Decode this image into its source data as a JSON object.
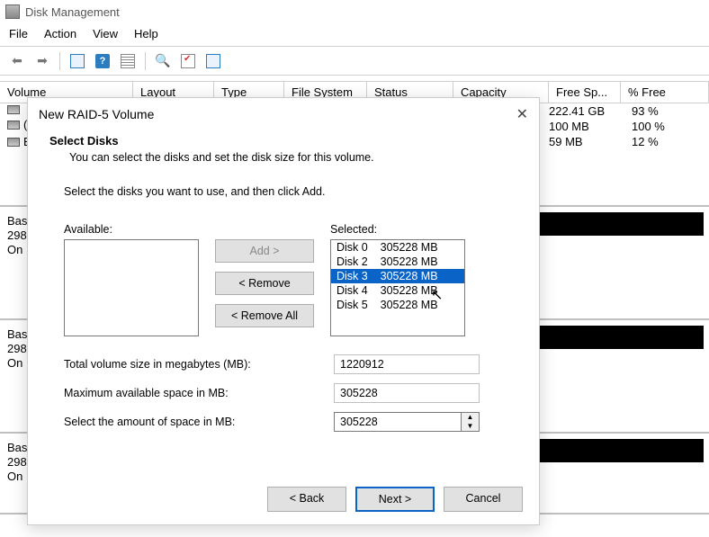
{
  "app": {
    "title": "Disk Management"
  },
  "menu": {
    "file": "File",
    "action": "Action",
    "view": "View",
    "help": "Help"
  },
  "columns": {
    "volume": "Volume",
    "layout": "Layout",
    "type": "Type",
    "fs": "File System",
    "status": "Status",
    "capacity": "Capacity",
    "free": "Free Sp...",
    "pct": "% Free"
  },
  "visible_rows": [
    {
      "free": "222.41 GB",
      "pct": "93 %"
    },
    {
      "free": "100 MB",
      "pct": "100 %"
    },
    {
      "free": "59 MB",
      "pct": "12 %"
    }
  ],
  "disk_panels": [
    {
      "l1": "Bas",
      "l2": "298",
      "l3": "On"
    },
    {
      "l1": "Bas",
      "l2": "298",
      "l3": "On"
    },
    {
      "l1": "Bas",
      "l2": "298",
      "l3": "On"
    }
  ],
  "wizard": {
    "title": "New RAID-5 Volume",
    "heading": "Select Disks",
    "subheading": "You can select the disks and set the disk size for this volume.",
    "instruction": "Select the disks you want to use, and then click Add.",
    "available_label": "Available:",
    "selected_label": "Selected:",
    "buttons": {
      "add": "Add >",
      "remove": "< Remove",
      "remove_all": "< Remove All",
      "back": "< Back",
      "next": "Next >",
      "cancel": "Cancel"
    },
    "selected_disks": [
      {
        "name": "Disk 0",
        "size": "305228 MB",
        "selected": false
      },
      {
        "name": "Disk 2",
        "size": "305228 MB",
        "selected": false
      },
      {
        "name": "Disk 3",
        "size": "305228 MB",
        "selected": true
      },
      {
        "name": "Disk 4",
        "size": "305228 MB",
        "selected": false
      },
      {
        "name": "Disk 5",
        "size": "305228 MB",
        "selected": false
      }
    ],
    "fields": {
      "total_label": "Total volume size in megabytes (MB):",
      "total_value": "1220912",
      "max_label": "Maximum available space in MB:",
      "max_value": "305228",
      "amount_label": "Select the amount of space in MB:",
      "amount_value": "305228"
    }
  }
}
